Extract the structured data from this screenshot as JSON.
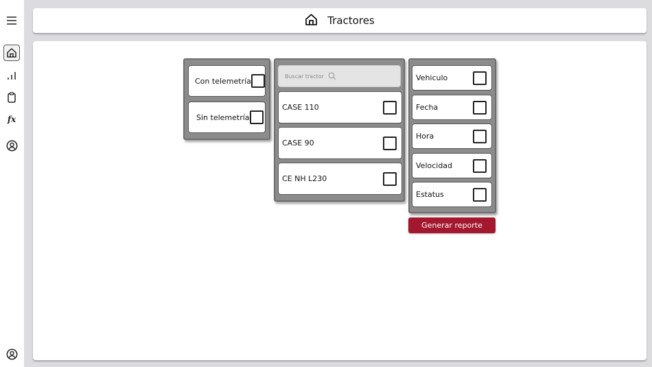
{
  "header": {
    "title": "Tractores",
    "icon": "home-icon"
  },
  "nav": {
    "top": [
      "menu-icon",
      "home-icon",
      "chart-icon",
      "clipboard-icon",
      "fx-icon",
      "user-icon"
    ],
    "fx_label": "fx",
    "bottom": "user-icon"
  },
  "telemetry_filter": {
    "options": [
      {
        "label": "Con telemetría",
        "checked": false
      },
      {
        "label": "Sin telemetría",
        "checked": false
      }
    ]
  },
  "tractor_list": {
    "search_placeholder": "Buscar tractor",
    "items": [
      {
        "label": "CASE 110",
        "checked": false
      },
      {
        "label": "CASE 90",
        "checked": false
      },
      {
        "label": "CE NH L230",
        "checked": false
      }
    ]
  },
  "report_fields": {
    "options": [
      {
        "label": "Vehiculo",
        "checked": false
      },
      {
        "label": "Fecha",
        "checked": false
      },
      {
        "label": "Hora",
        "checked": false
      },
      {
        "label": "Velocidad",
        "checked": false
      },
      {
        "label": "Estatus",
        "checked": false
      }
    ]
  },
  "actions": {
    "generate_label": "Generar reporte",
    "accent": "#a3182e"
  }
}
